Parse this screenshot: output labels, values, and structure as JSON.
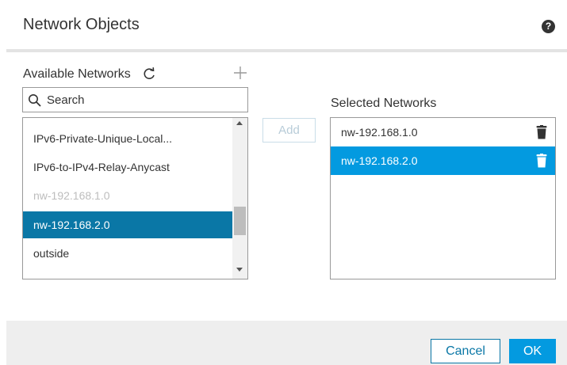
{
  "dialog": {
    "title": "Network Objects",
    "help_icon": "help-icon",
    "help_glyph": "?"
  },
  "available": {
    "label": "Available Networks",
    "refresh_icon": "refresh-icon",
    "add_icon": "plus-icon",
    "search": {
      "placeholder": "Search",
      "value": ""
    },
    "items": [
      {
        "label": "IPv6-Private-Unique-Local...",
        "state": "normal"
      },
      {
        "label": "IPv6-to-IPv4-Relay-Anycast",
        "state": "normal"
      },
      {
        "label": "nw-192.168.1.0",
        "state": "disabled"
      },
      {
        "label": "nw-192.168.2.0",
        "state": "selected"
      },
      {
        "label": "outside",
        "state": "normal"
      }
    ]
  },
  "add_button": {
    "label": "Add",
    "enabled": false
  },
  "selected": {
    "label": "Selected Networks",
    "items": [
      {
        "label": "nw-192.168.1.0",
        "selected": false,
        "icon": "trash-icon"
      },
      {
        "label": "nw-192.168.2.0",
        "selected": true,
        "icon": "trash-icon"
      }
    ]
  },
  "footer": {
    "cancel_label": "Cancel",
    "ok_label": "OK"
  },
  "colors": {
    "list_selected": "#0a77a6",
    "selected_highlight": "#039ae0",
    "disabled_text": "#bdbdbd",
    "footer_bg": "#eeeeee"
  }
}
